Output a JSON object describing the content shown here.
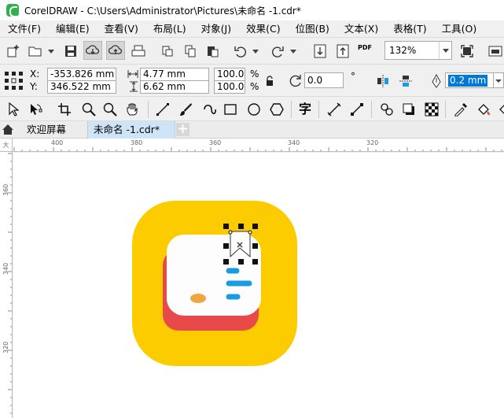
{
  "window": {
    "title": "CorelDRAW - C:\\Users\\Administrator\\Pictures\\未命名 -1.cdr*"
  },
  "menu": [
    "文件(F)",
    "编辑(E)",
    "查看(V)",
    "布局(L)",
    "对象(J)",
    "效果(C)",
    "位图(B)",
    "文本(X)",
    "表格(T)",
    "工具(O)"
  ],
  "toolbar": {
    "zoom": "132%",
    "pdf_label": "PDF"
  },
  "property_bar": {
    "x_label": "X:",
    "x_value": "-353.826 mm",
    "y_label": "Y:",
    "y_value": "346.522 mm",
    "width_value": "4.77 mm",
    "height_value": "6.62 mm",
    "scale_x": "100.0",
    "scale_y": "100.0",
    "percent": "%",
    "rotation": "0.0",
    "degree": "°",
    "outline_width": "0.2 mm"
  },
  "tabs": {
    "welcome": "欢迎屏幕",
    "document": "未命名 -1.cdr*",
    "add": "+"
  },
  "ruler": {
    "corner": "大",
    "h_ticks": [
      "400",
      "380",
      "360",
      "340",
      "320"
    ],
    "v_ticks": [
      "360",
      "340",
      "320"
    ]
  },
  "colors": {
    "icon_bg": "#fccc00",
    "shadow": "#e84a4a",
    "card": "#fdfdfd",
    "dot": "#f2a63f",
    "lines": "#1a9ce0"
  }
}
